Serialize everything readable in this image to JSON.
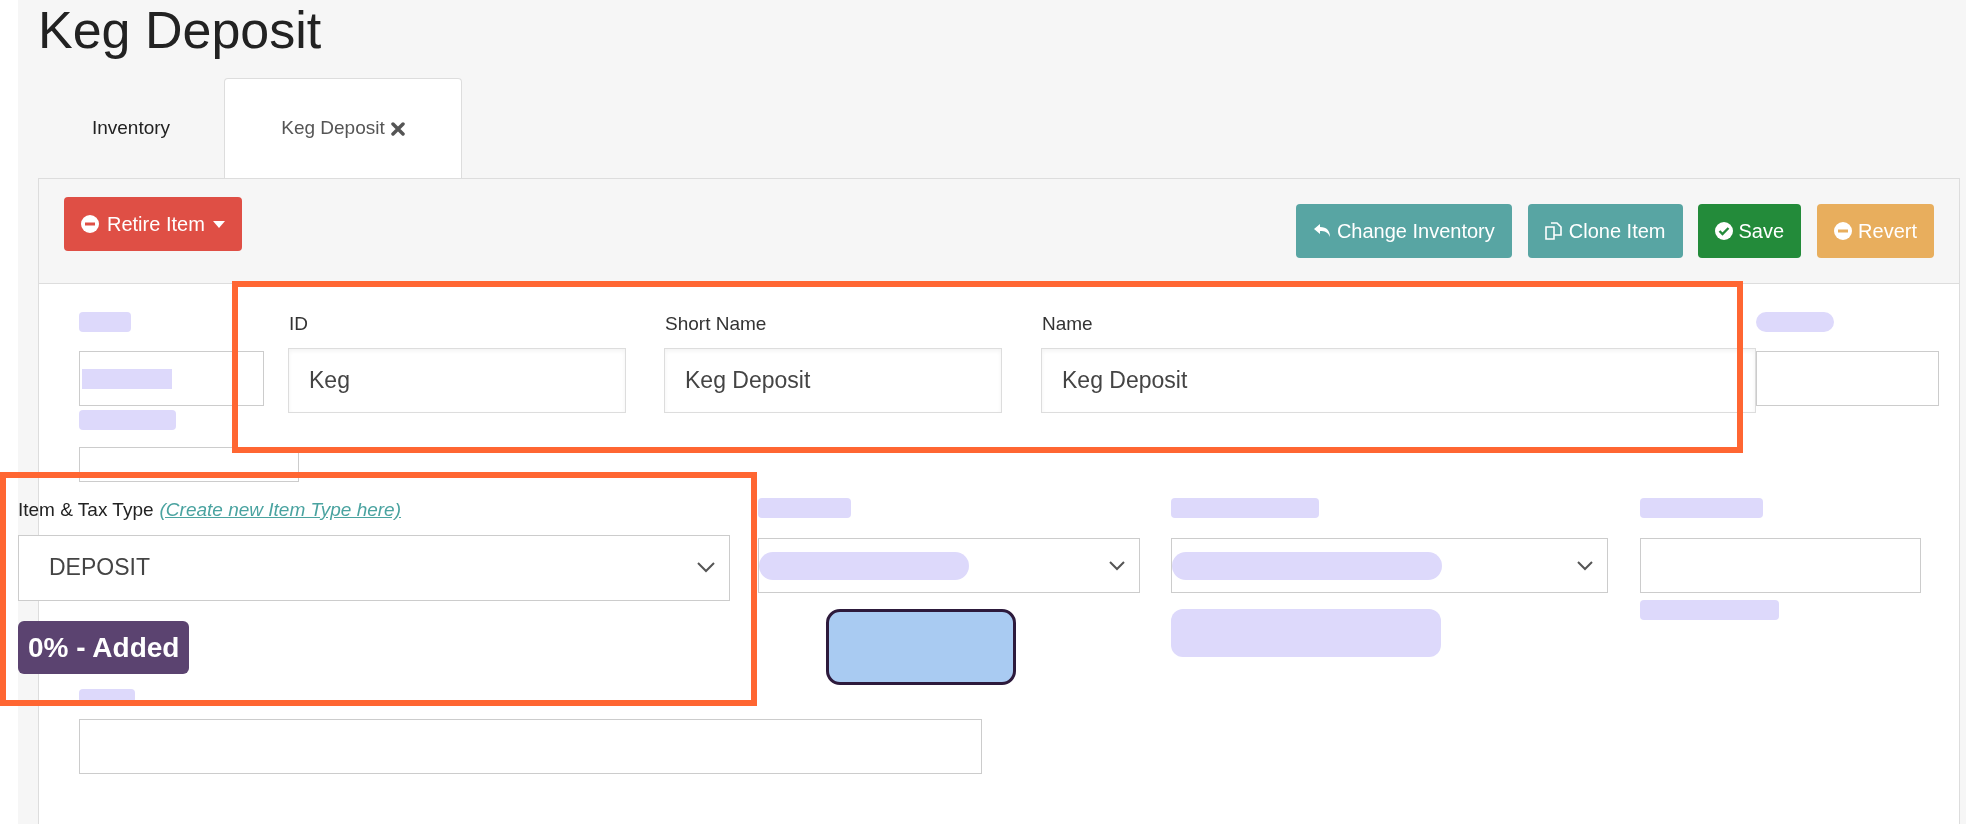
{
  "page_title": "Keg Deposit",
  "tabs": [
    {
      "label": "Inventory",
      "selected": false,
      "closable": false
    },
    {
      "label": "Keg Deposit",
      "selected": true,
      "closable": true
    }
  ],
  "toolbar": {
    "retire": {
      "label": "Retire Item"
    },
    "actions": [
      {
        "label": "Change Inventory",
        "kind": "change"
      },
      {
        "label": "Clone Item",
        "kind": "clone"
      },
      {
        "label": "Save",
        "kind": "save"
      },
      {
        "label": "Revert",
        "kind": "revert"
      }
    ]
  },
  "fields": [
    {
      "label": "ID",
      "value": "Keg"
    },
    {
      "label": "Short Name",
      "value": "Keg Deposit"
    },
    {
      "label": "Name",
      "value": "Keg Deposit"
    }
  ],
  "item_type": {
    "label": "Item & Tax Type",
    "link": "(Create new Item Type here)",
    "value": "DEPOSIT",
    "badge": "0% - Added"
  }
}
